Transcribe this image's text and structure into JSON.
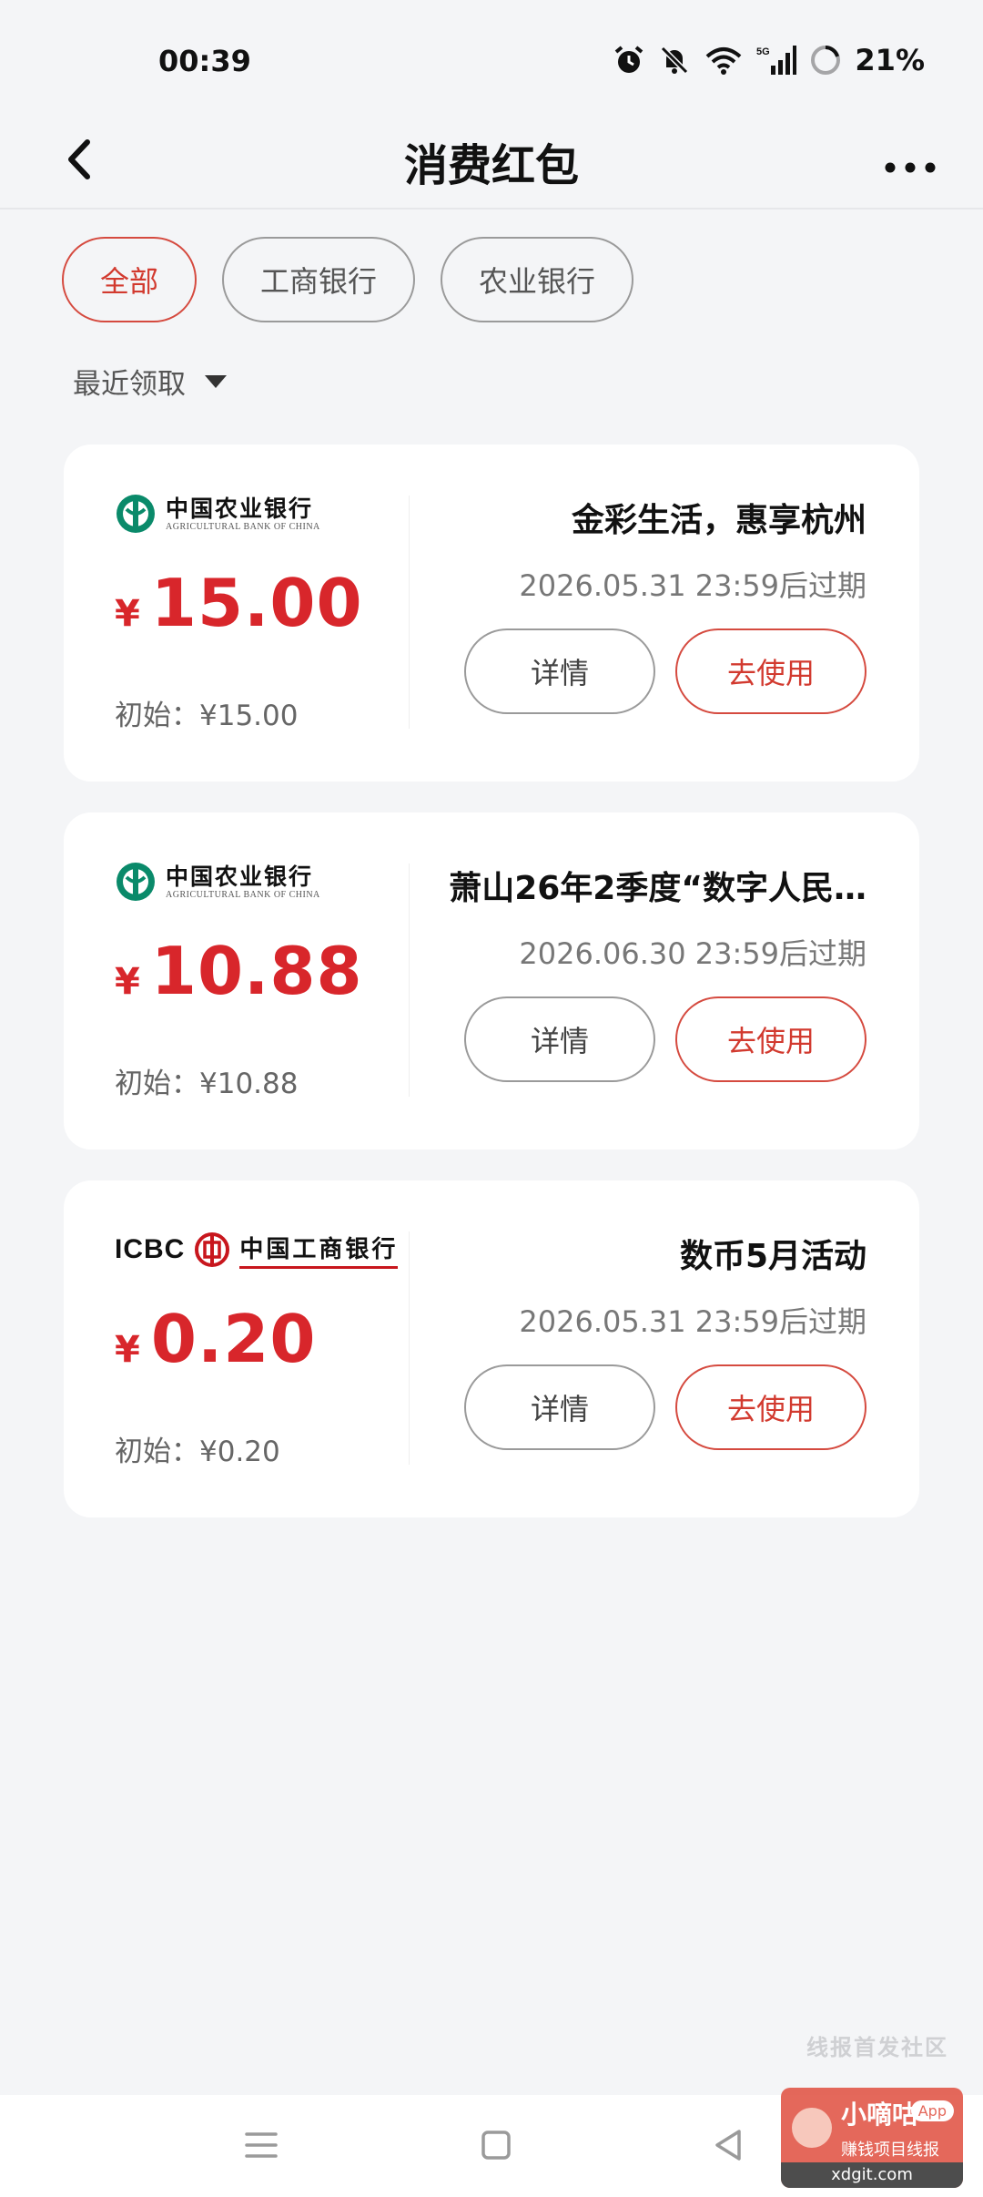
{
  "status_bar": {
    "time": "00:39",
    "battery": "21%",
    "icons": [
      "alarm-icon",
      "mute-bell-icon",
      "wifi-icon",
      "5g-signal-icon",
      "battery-ring-icon"
    ]
  },
  "nav": {
    "title": "消费红包",
    "back_icon": "chevron-left-icon",
    "more_icon": "more-dots-icon"
  },
  "filters": [
    {
      "label": "全部",
      "selected": true
    },
    {
      "label": "工商银行",
      "selected": false
    },
    {
      "label": "农业银行",
      "selected": false
    }
  ],
  "sort": {
    "label": "最近领取",
    "icon": "caret-down-icon"
  },
  "cards": [
    {
      "bank_cn": "中国农业银行",
      "bank_en": "AGRICULTURAL BANK OF CHINA",
      "currency": "¥",
      "amount": "15.00",
      "initial": "初始：¥15.00",
      "title": "金彩生活，惠享杭州",
      "expiry": "2026.05.31 23:59后过期",
      "detail_label": "详情",
      "use_label": "去使用"
    },
    {
      "bank_cn": "中国农业银行",
      "bank_en": "AGRICULTURAL BANK OF CHINA",
      "currency": "¥",
      "amount": "10.88",
      "initial": "初始：¥10.88",
      "title": "萧山26年2季度“数字人民…",
      "expiry": "2026.06.30 23:59后过期",
      "detail_label": "详情",
      "use_label": "去使用"
    },
    {
      "bank_latin": "ICBC",
      "bank_cn": "中国工商银行",
      "currency": "¥",
      "amount": "0.20",
      "initial": "初始：¥0.20",
      "title": "数币5月活动",
      "expiry": "2026.05.31 23:59后过期",
      "detail_label": "详情",
      "use_label": "去使用"
    }
  ],
  "watermark": {
    "text": "线报首发社区",
    "badge_title": "小嘀咕",
    "badge_app": "App",
    "badge_sub": "赚钱项目线报",
    "badge_url": "xdgit.com"
  },
  "colors": {
    "accent_red": "#d23a2f",
    "amount_red": "#d8262b",
    "abc_green": "#0a8a6a",
    "icbc_red": "#c8161d",
    "background": "#f4f5f7"
  },
  "system_nav": {
    "icons": [
      "menu-icon",
      "home-square-icon",
      "back-triangle-icon"
    ]
  }
}
